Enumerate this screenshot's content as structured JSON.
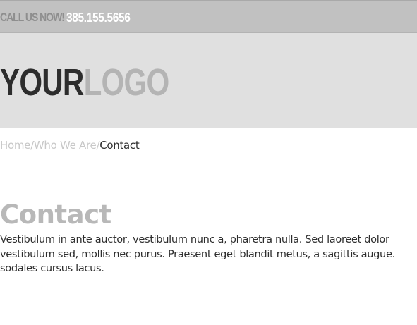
{
  "topbar": {
    "call_label": "CALL US NOW!",
    "phone": "385.155.5656"
  },
  "logo": {
    "your": "YOUR",
    "logo": "LOGO"
  },
  "breadcrumb": {
    "items": [
      "Home",
      "Who We Are",
      "Contact"
    ],
    "separator": "/"
  },
  "page": {
    "title": "Contact",
    "body_lines": [
      "Vestibulum in ante auctor, vestibulum nunc a, pharetra nulla. Sed laoreet dolor",
      "vestibulum sed, mollis nec purus. Praesent eget blandit metus, a sagittis augue.",
      "sodales cursus lacus."
    ]
  },
  "colors": {
    "topbar_bg": "#c1c1c1",
    "header_bg": "#e0e0e0",
    "text_dark": "#2d2d2d",
    "text_muted": "#b8b8b8"
  }
}
